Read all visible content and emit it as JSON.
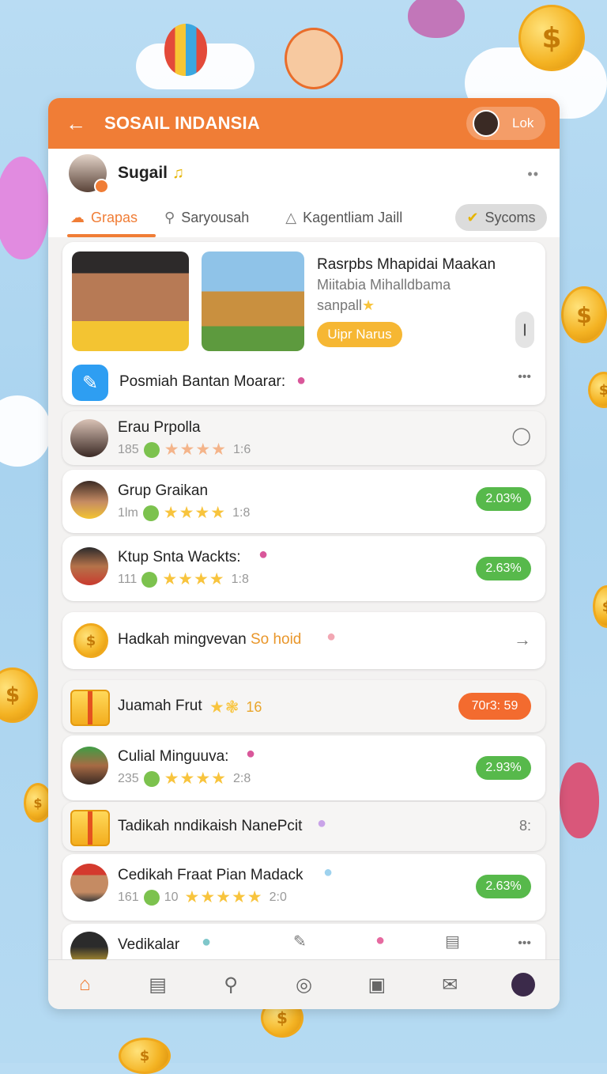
{
  "app": {
    "title": "SOSAIL INDANSIA",
    "login_label": "Lok"
  },
  "profile": {
    "name": "Sugail"
  },
  "tabs": [
    {
      "label": "Grapas",
      "icon": "cloud-icon"
    },
    {
      "label": "Saryousah",
      "icon": "search-icon"
    },
    {
      "label": "Kagentliam Jaill",
      "icon": "triangle-icon"
    },
    {
      "label": "Sycoms",
      "icon": "check-icon"
    }
  ],
  "featured": {
    "title": "Rasrpbs Mhapidai Maakan",
    "line2": "Miitabia Mihalldbama",
    "line3": "sanpall",
    "cta": "Uipr Narus",
    "promo": "Posmiah Bantan Moarar:"
  },
  "rows": [
    {
      "title": "Erau Prpolla",
      "count": "185",
      "score": "1:6"
    },
    {
      "title": "Grup Graikan",
      "count": "1lm",
      "score": "1:8",
      "pct": "2.03%"
    },
    {
      "title": "Ktup Snta Wackts:",
      "count": "111",
      "score": "1:8",
      "pct": "2.63%"
    },
    {
      "title": "Hadkah mingvevan",
      "highlight": "So hoid"
    },
    {
      "title": "Juamah Frut",
      "count": "16",
      "timer": "70r3: 59"
    },
    {
      "title": "Culial Minguuva:",
      "count": "235",
      "score": "2:8",
      "pct": "2.93%"
    },
    {
      "title": "Tadikah nndikaish NanePcit",
      "count": "8:"
    },
    {
      "title": "Cedikah Fraat Pian Madack",
      "count": "161",
      "count2": "10",
      "score": "2:0",
      "pct": "2.63%"
    },
    {
      "title": "Vedikalar"
    }
  ],
  "nav": [
    "home-icon",
    "list-icon",
    "search-icon",
    "explore-icon",
    "bookmark-icon",
    "mail-icon",
    "profile-icon"
  ],
  "colors": {
    "accent": "#f07d36",
    "positive": "#57b94b",
    "timer": "#f36b2f",
    "cta": "#f6b733"
  }
}
